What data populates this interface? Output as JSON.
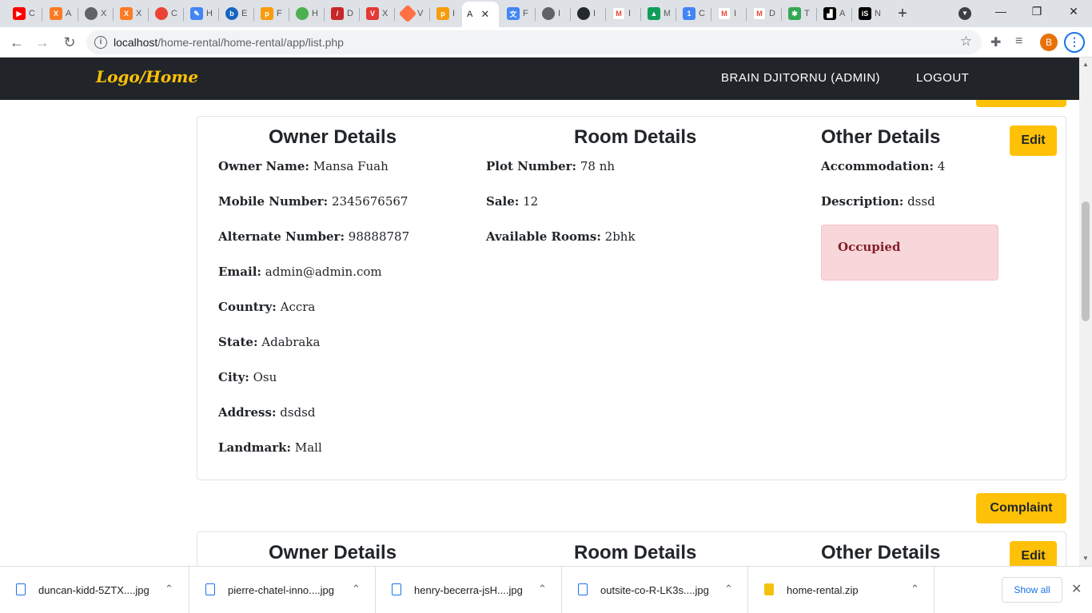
{
  "browser": {
    "active_tab_title": "A",
    "url_host": "localhost",
    "url_path": "/home-rental/home-rental/app/list.php",
    "profile_initial": "B"
  },
  "nav": {
    "brand": "Logo/Home",
    "user": "BRAIN DJITORNU (ADMIN)",
    "logout": "LOGOUT"
  },
  "listing": {
    "edit_label": "Edit",
    "complaint_label": "Complaint",
    "owner_heading": "Owner Details",
    "room_heading": "Room Details",
    "other_heading": "Other Details",
    "owner": [
      {
        "label": "Owner Name:",
        "value": "Mansa Fuah"
      },
      {
        "label": "Mobile Number:",
        "value": "2345676567"
      },
      {
        "label": "Alternate Number:",
        "value": "98888787"
      },
      {
        "label": "Email:",
        "value": "admin@admin.com"
      },
      {
        "label": "Country:",
        "value": "Accra"
      },
      {
        "label": "State:",
        "value": "Adabraka"
      },
      {
        "label": "City:",
        "value": "Osu"
      },
      {
        "label": "Address:",
        "value": "dsdsd"
      },
      {
        "label": "Landmark:",
        "value": "Mall"
      }
    ],
    "room": [
      {
        "label": "Plot Number:",
        "value": "78 nh"
      },
      {
        "label": "Sale:",
        "value": "12"
      },
      {
        "label": "Available Rooms:",
        "value": "2bhk"
      }
    ],
    "other": [
      {
        "label": "Accommodation:",
        "value": "4"
      },
      {
        "label": "Description:",
        "value": "dssd"
      }
    ],
    "status": "Occupied"
  },
  "downloads": {
    "items": [
      "duncan-kidd-5ZTX....jpg",
      "pierre-chatel-inno....jpg",
      "henry-becerra-jsH....jpg",
      "outsite-co-R-LK3s....jpg",
      "home-rental.zip"
    ],
    "show_all": "Show all"
  }
}
